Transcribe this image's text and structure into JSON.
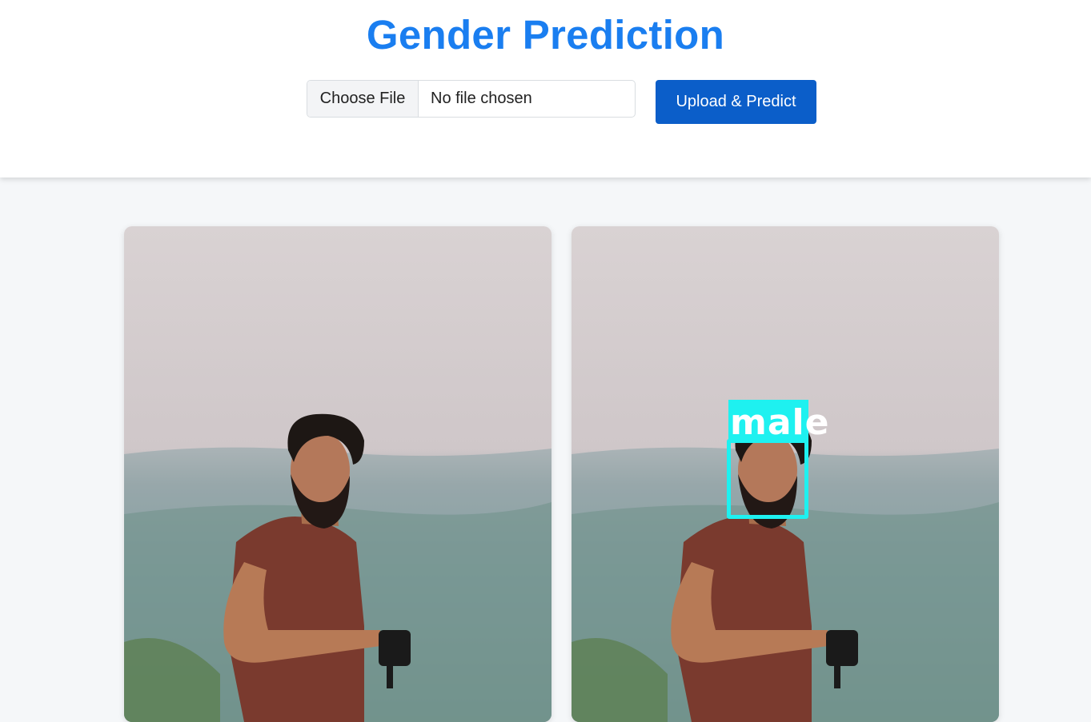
{
  "header": {
    "title": "Gender Prediction",
    "file_input": {
      "button_label": "Choose File",
      "status": "No file chosen"
    },
    "upload_button_label": "Upload & Predict"
  },
  "results": {
    "original_image": {
      "icon": "photo-man-with-camera"
    },
    "predicted_image": {
      "icon": "photo-man-with-camera-annotated",
      "prediction_label": "male"
    }
  },
  "colors": {
    "title": "#1a7ef0",
    "button": "#0b5ec9",
    "detection_box": "#1ef1f0"
  }
}
